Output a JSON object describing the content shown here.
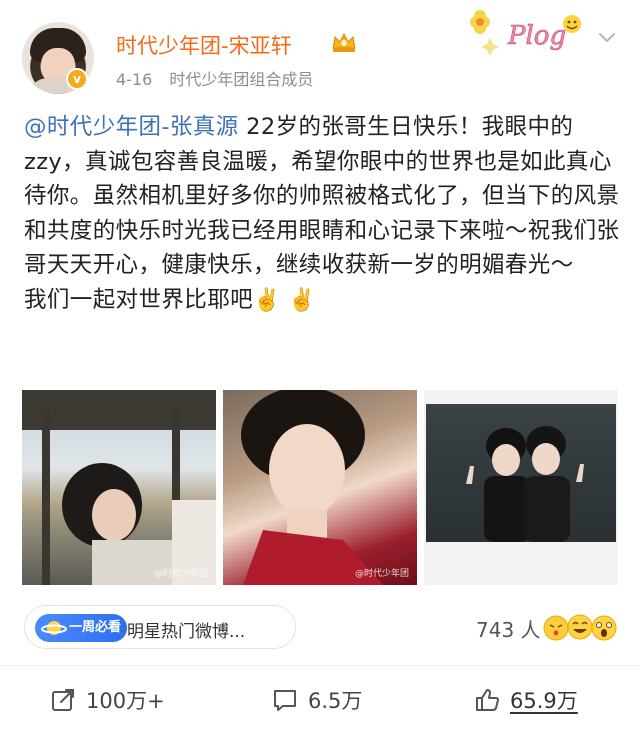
{
  "post": {
    "author": {
      "name": "时代少年团-宋亚轩",
      "verified": true
    },
    "date": "4-16",
    "source": "时代少年团组合成员",
    "mention": "@时代少年团-张真源",
    "text": " 22岁的张哥生日快乐！我眼中的zzy，真诚包容善良温暖，希望你眼中的世界也是如此真心待你。虽然相机里好多你的帅照被格式化了，但当下的风景和共度的快乐时光我已经用眼睛和心记录下来啦～祝我们张哥天天开心，健康快乐，继续收获新一岁的明媚春光～",
    "text_last_line": "我们一起对世界比耶吧",
    "emojis": [
      "✌️",
      "✌️"
    ],
    "plog_label": "Plog",
    "photos": [
      {
        "label": "photo-1",
        "watermark": "@时代少年团"
      },
      {
        "label": "photo-2",
        "watermark": "@时代少年团"
      },
      {
        "label": "photo-3",
        "watermark": ""
      }
    ]
  },
  "topic": {
    "tag": "一周必看",
    "title": "明星热门微博..."
  },
  "reactions": {
    "count": "743 人"
  },
  "actions": {
    "repost": "100万+",
    "comment": "6.5万",
    "like": "65.9万"
  },
  "colors": {
    "username": "#f76a15",
    "mention": "#3e72b8",
    "meta": "#8d8d8d"
  }
}
